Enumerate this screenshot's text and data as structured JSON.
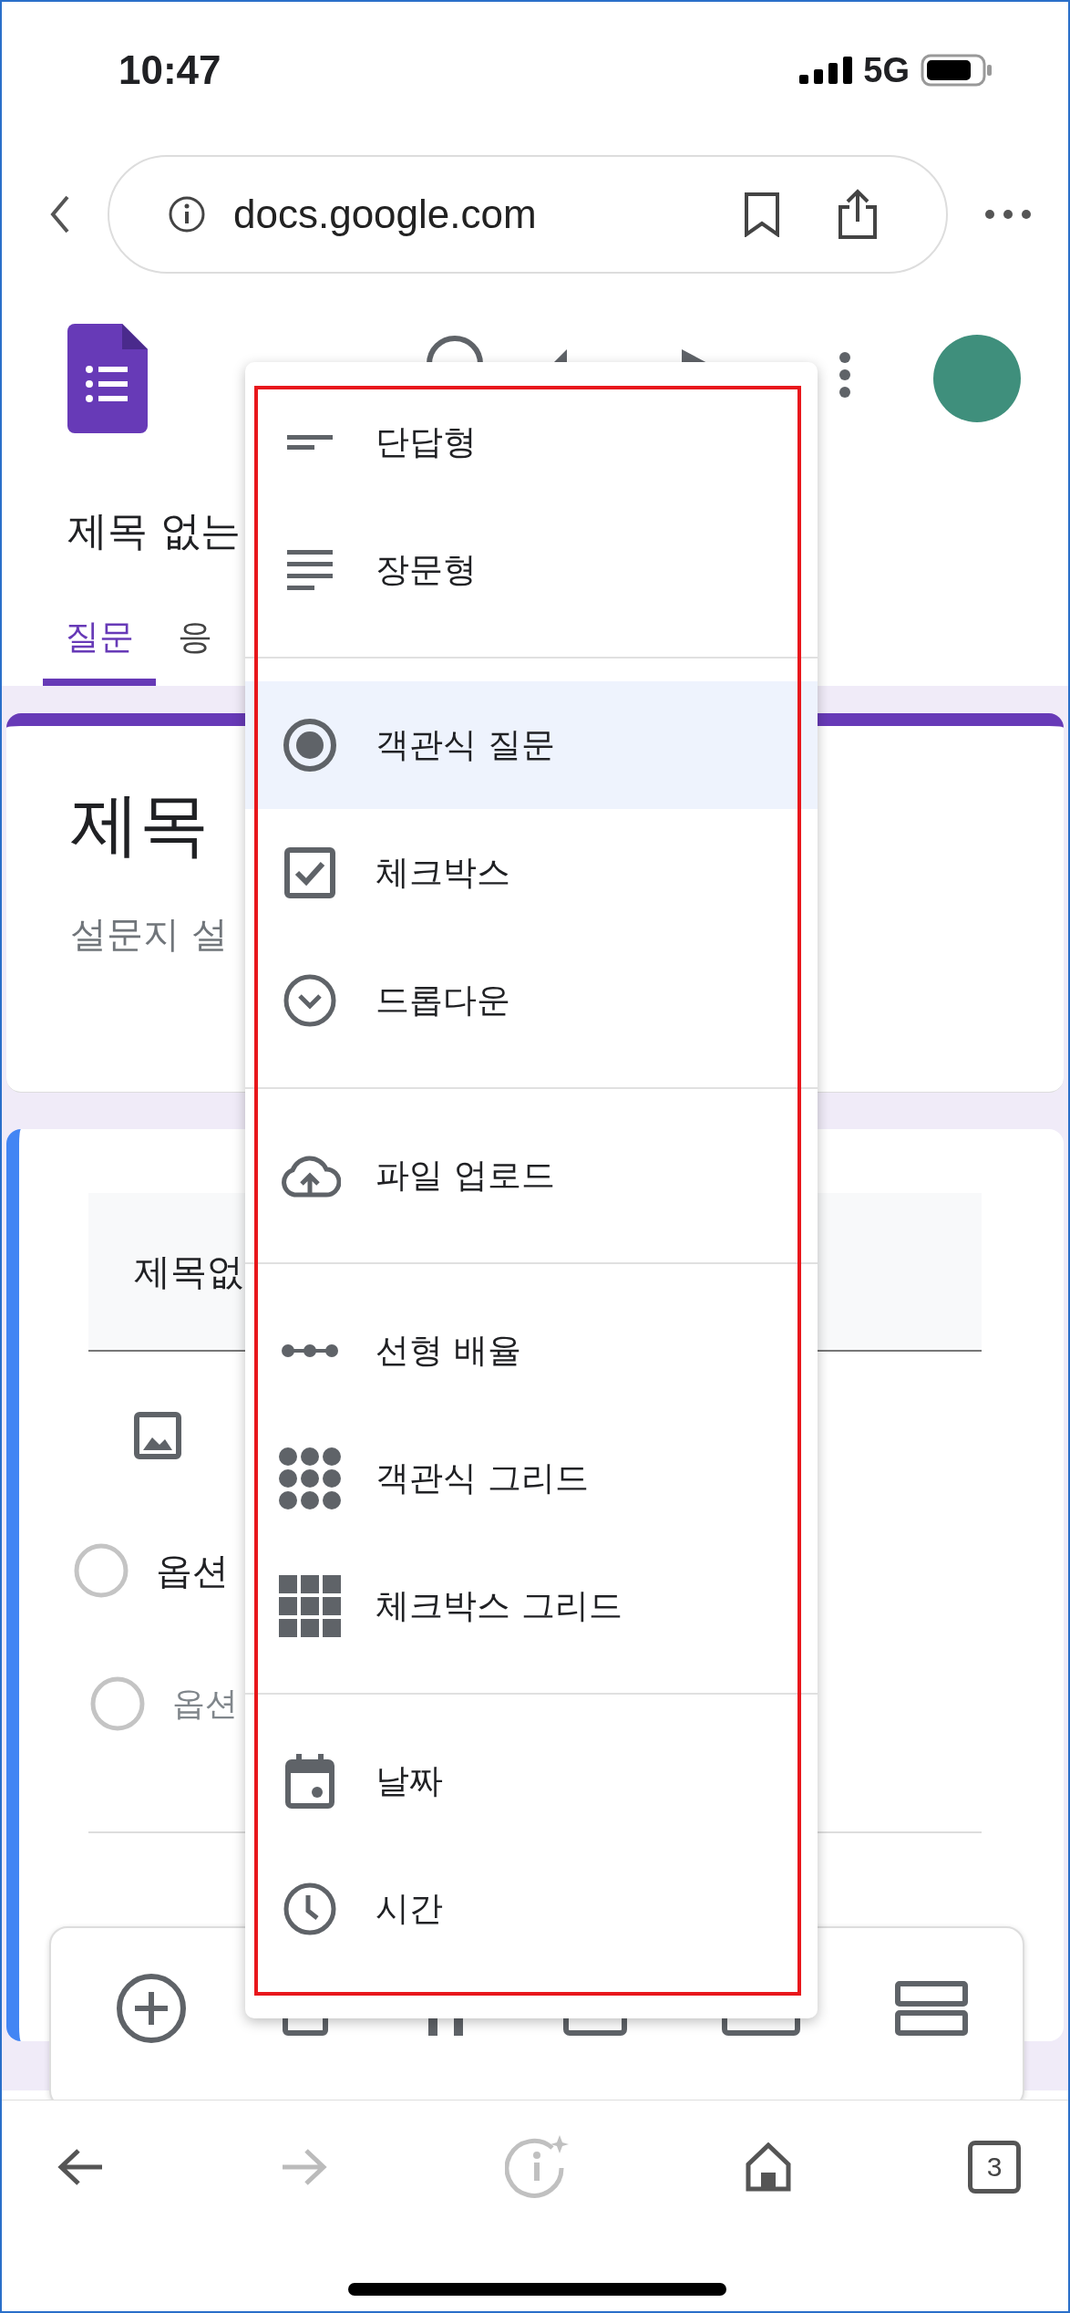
{
  "status_bar": {
    "time": "10:47",
    "network": "5G"
  },
  "browser": {
    "url": "docs.google.com"
  },
  "form": {
    "title": "제목 없는",
    "tabs": [
      {
        "label": "질문",
        "selected": true
      },
      {
        "label": "응",
        "selected": false
      }
    ],
    "header_card": {
      "title": "제목",
      "description": "설문지 설"
    },
    "question": {
      "title": "제목없",
      "options": [
        {
          "label": "옵션",
          "kind": "option"
        },
        {
          "label": "옵션",
          "kind": "add"
        }
      ]
    }
  },
  "type_menu": {
    "sections": [
      {
        "items": [
          {
            "label": "단답형",
            "kind": "short",
            "selected": false
          },
          {
            "label": "장문형",
            "kind": "paragraph",
            "selected": false
          }
        ]
      },
      {
        "items": [
          {
            "label": "객관식 질문",
            "kind": "radio",
            "selected": true
          },
          {
            "label": "체크박스",
            "kind": "checkbox",
            "selected": false
          },
          {
            "label": "드롭다운",
            "kind": "dropdown",
            "selected": false
          }
        ]
      },
      {
        "items": [
          {
            "label": "파일 업로드",
            "kind": "upload",
            "selected": false
          }
        ]
      },
      {
        "items": [
          {
            "label": "선형 배율",
            "kind": "linear",
            "selected": false
          },
          {
            "label": "객관식 그리드",
            "kind": "grid_radio",
            "selected": false
          },
          {
            "label": "체크박스 그리드",
            "kind": "grid_check",
            "selected": false
          }
        ]
      },
      {
        "items": [
          {
            "label": "날짜",
            "kind": "date",
            "selected": false
          },
          {
            "label": "시간",
            "kind": "time",
            "selected": false
          }
        ]
      }
    ]
  },
  "bottom_bar": {
    "tab_count": "3"
  }
}
